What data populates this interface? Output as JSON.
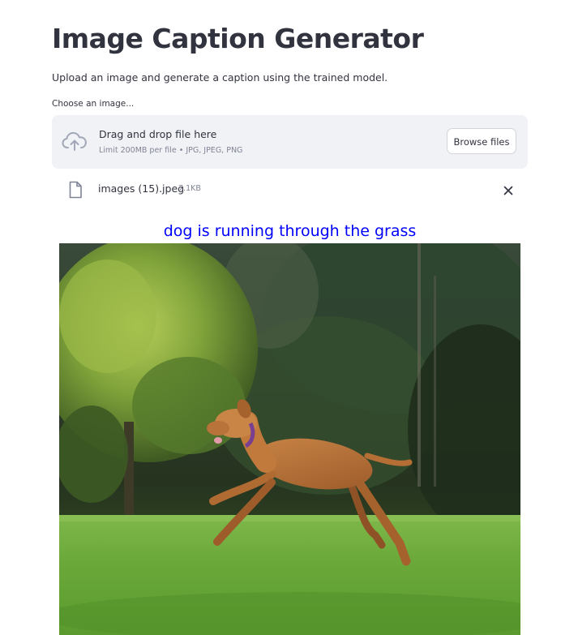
{
  "header": {
    "title": "Image Caption Generator",
    "subtitle": "Upload an image and generate a caption using the trained model."
  },
  "uploader": {
    "label": "Choose an image...",
    "drop_text": "Drag and drop file here",
    "limit_text": "Limit 200MB per file • JPG, JPEG, PNG",
    "browse_label": "Browse files",
    "icon": "cloud-upload-icon"
  },
  "uploaded_file": {
    "name": "images (15).jpeg",
    "size": "7.1KB",
    "icon": "file-icon",
    "remove_icon": "close-icon"
  },
  "result": {
    "caption": "dog is running through the grass",
    "caption_color": "#0000ff"
  },
  "colors": {
    "text": "#31333f",
    "muted": "#808495",
    "dropzone_bg": "#f0f2f6"
  }
}
